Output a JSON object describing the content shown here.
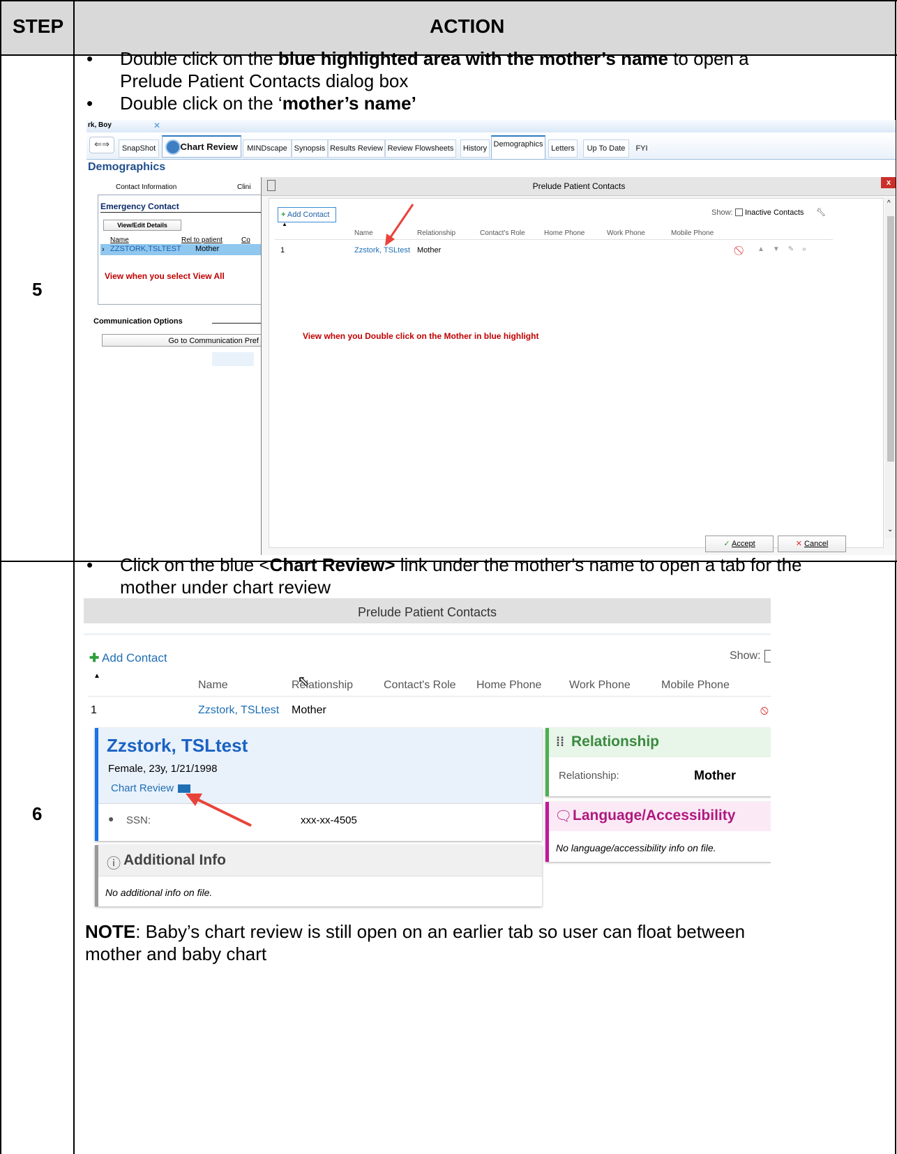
{
  "table": {
    "header_step": "STEP",
    "header_action": "ACTION"
  },
  "step5": {
    "number": "5",
    "bullet1_pre": "Double click on the ",
    "bullet1_bold": "blue highlighted area with the mother’s name",
    "bullet1_post": " to open a",
    "bullet1_line2": "Prelude Patient Contacts dialog box",
    "bullet2_pre": "Double click on the ‘",
    "bullet2_bold": "mother’s name’"
  },
  "s1": {
    "patient_tab": "rk, Boy",
    "tabs": [
      "SnapShot",
      "Chart Review",
      "MINDscape",
      "Synopsis",
      "Results Review",
      "Review Flowsheets",
      "History",
      "Demographics",
      "Letters",
      "Up To Date",
      "FYI"
    ],
    "page_title": "Demographics",
    "sub_contact_info": "Contact Information",
    "sub_clini": "Clini",
    "emergency_contact": "Emergency Contact",
    "view_edit": "View/Edit Details",
    "col_name": "Name",
    "col_rel": "Rel to patient",
    "col_c": "Co",
    "row_name": "ZZSTORK,TSLTEST",
    "row_rel": "Mother",
    "note_view_all": "View when you select View All",
    "comm_options": "Communication Options",
    "go_to_comm": "Go to Communication Pref",
    "dialog_title": "Prelude Patient Contacts",
    "add_contact": "Add Contact",
    "show_label": "Show:",
    "inactive_contacts": "Inactive Contacts",
    "cols": [
      "Name",
      "Relationship",
      "Contact's Role",
      "Home Phone",
      "Work Phone",
      "Mobile Phone"
    ],
    "row_num": "1",
    "row_contact_name": "Zzstork, TSLtest",
    "row_contact_rel": "Mother",
    "note_double_click": "View when you Double click on the Mother in blue highlight",
    "accept": "Accept",
    "cancel": "Cancel"
  },
  "step6": {
    "number": "6",
    "bullet1_pre": "Click on the blue <",
    "bullet1_bold": "Chart Review>",
    "bullet1_post": " link under the mother’s name to open a tab for the",
    "bullet1_line2": "mother under chart review",
    "note_bold": "NOTE",
    "note_text": ": Baby’s chart review is still open on an earlier tab so user can float between",
    "note_line2": "mother and baby chart"
  },
  "s2": {
    "dialog_title": "Prelude Patient Contacts",
    "add_contact": "Add Contact",
    "show_label": "Show:",
    "cols": [
      "Name",
      "Relationship",
      "Contact's Role",
      "Home Phone",
      "Work Phone",
      "Mobile Phone"
    ],
    "row_num": "1",
    "row_name": "Zzstork, TSLtest",
    "row_rel": "Mother",
    "card_name": "Zzstork, TSLtest",
    "card_demo": "Female, 23y, 1/21/1998",
    "chart_review_link": "Chart Review",
    "ssn_label": "SSN:",
    "ssn_value": "xxx-xx-4505",
    "additional_info_title": "Additional Info",
    "additional_info_text": "No additional info on file.",
    "relationship_title": "Relationship",
    "relationship_label": "Relationship:",
    "relationship_value": "Mother",
    "language_title": "Language/Accessibility",
    "language_text": "No language/accessibility info on file."
  },
  "colors": {
    "header_bg": "#d9d9d9",
    "epic_blue": "#1f6fb5",
    "highlight": "#8fc7ef",
    "note_red": "#c00000",
    "arrow_red": "#e8433a",
    "relationship_green": "#4caf50",
    "language_magenta": "#c2189a"
  }
}
